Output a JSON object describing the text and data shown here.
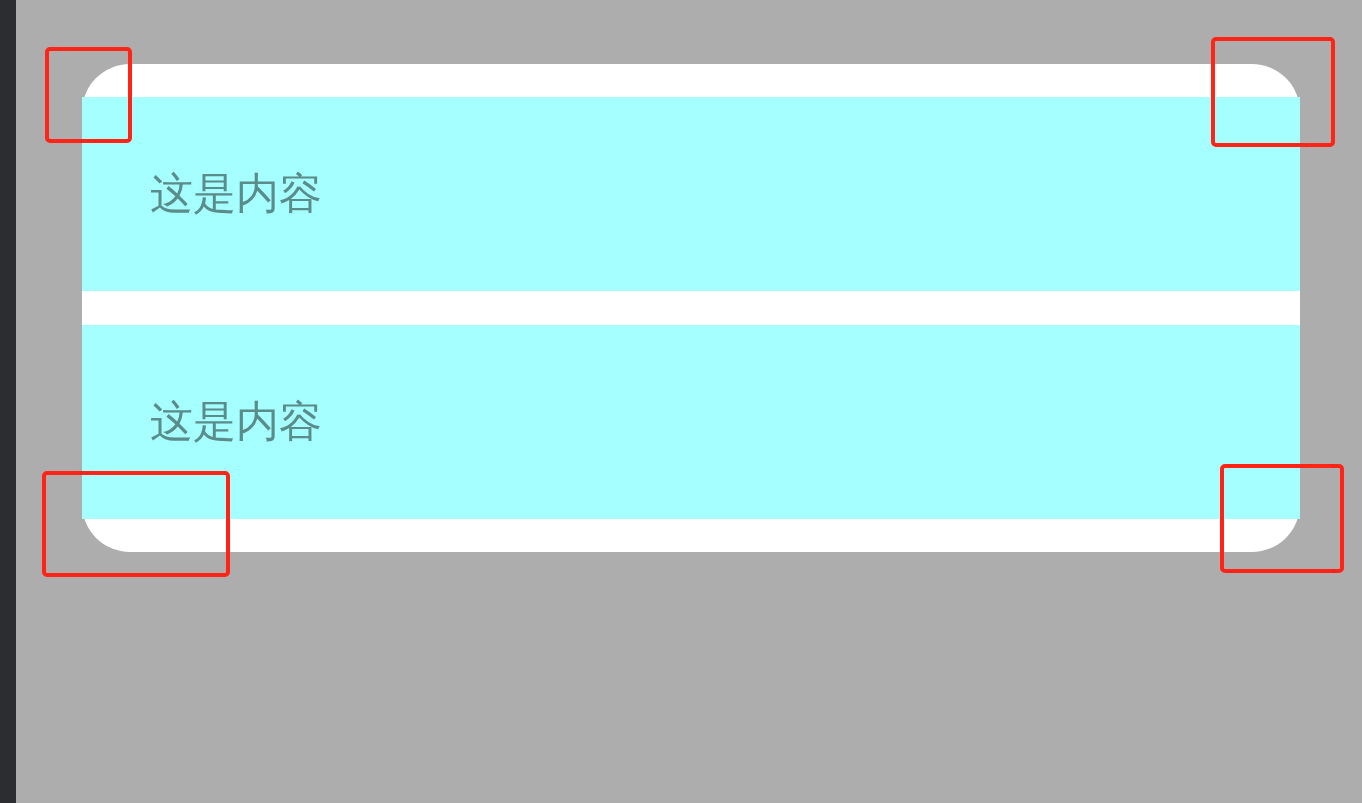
{
  "card": {
    "rows": [
      {
        "text": "这是内容"
      },
      {
        "text": "这是内容"
      }
    ]
  },
  "annotations": [
    {
      "kind": "frame"
    },
    {
      "kind": "frame"
    },
    {
      "kind": "frame"
    },
    {
      "kind": "frame"
    }
  ]
}
